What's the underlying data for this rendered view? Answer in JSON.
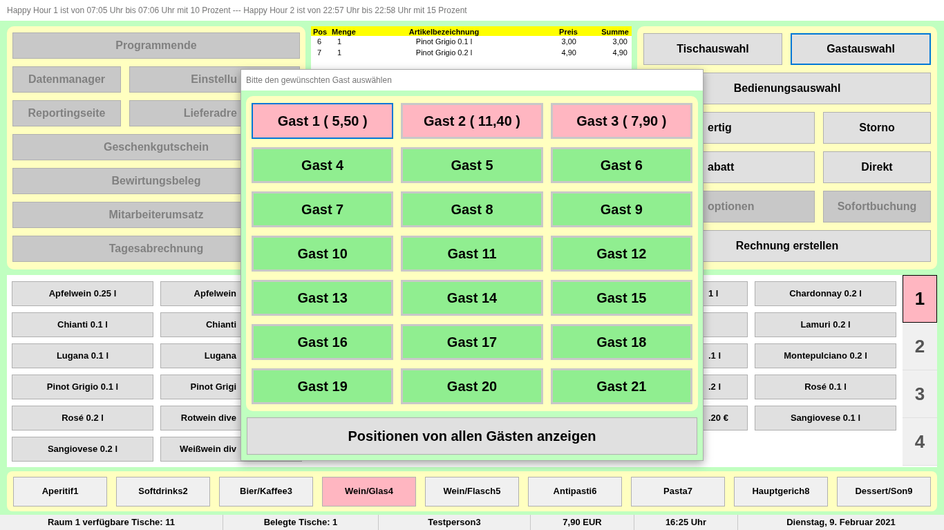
{
  "happy_hour_banner": "Happy Hour 1 ist von 07:05 Uhr bis 07:06 Uhr mit 10 Prozent --- Happy Hour 2 ist von 22:57 Uhr bis 22:58 Uhr mit 15 Prozent",
  "menu_panel": {
    "rows": [
      [
        {
          "label": "Programmende",
          "disabled": true
        }
      ],
      [
        {
          "label": "Datenmanager",
          "disabled": true
        },
        {
          "label": "Einstellu",
          "disabled": true
        }
      ],
      [
        {
          "label": "Reportingseite",
          "disabled": true
        },
        {
          "label": "Lieferadre",
          "disabled": true
        }
      ],
      [
        {
          "label": "Geschenkgutschein",
          "disabled": true
        }
      ],
      [
        {
          "label": "Bewirtungsbeleg",
          "disabled": true
        }
      ],
      [
        {
          "label": "Mitarbeiterumsatz",
          "disabled": true
        }
      ],
      [
        {
          "label": "Tagesabrechnung",
          "disabled": true
        }
      ]
    ]
  },
  "order_table": {
    "columns": [
      "Pos",
      "Menge",
      "Artikelbezeichnung",
      "Preis",
      "Summe"
    ],
    "rows": [
      [
        "6",
        "1",
        "Pinot Grigio 0.1 l",
        "3,00",
        "3,00"
      ],
      [
        "7",
        "1",
        "Pinot Grigio 0.2 l",
        "4,90",
        "4,90"
      ]
    ]
  },
  "action_panel": {
    "rows": [
      [
        {
          "label": "Tischauswahl",
          "disabled": false,
          "focused": false
        },
        {
          "label": "Gastauswahl",
          "disabled": false,
          "focused": true
        }
      ],
      [
        {
          "label": "Bedienungsauswahl",
          "disabled": false,
          "focused": false
        }
      ],
      [
        {
          "label": "ertig",
          "disabled": false,
          "focused": false
        },
        {
          "label": "Storno",
          "disabled": false,
          "focused": false
        }
      ],
      [
        {
          "label": "abatt",
          "disabled": false,
          "focused": false
        },
        {
          "label": "Direkt",
          "disabled": false,
          "focused": false
        }
      ],
      [
        {
          "label": "optionen",
          "disabled": true,
          "focused": false
        },
        {
          "label": "Sofortbuchung",
          "disabled": true,
          "focused": false
        }
      ],
      [
        {
          "label": "Rechnung erstellen",
          "disabled": false,
          "focused": false
        }
      ]
    ]
  },
  "article_columns": [
    [
      {
        "label": "Apfelwein 0.25 l"
      },
      {
        "label": "Chianti 0.1 l"
      },
      {
        "label": "Lugana 0.1 l"
      },
      {
        "label": "Pinot Grigio 0.1 l"
      },
      {
        "label": "Rosé 0.2 l"
      },
      {
        "label": "Sangiovese 0.2 l"
      }
    ],
    [
      {
        "label": "Apfelwein"
      },
      {
        "label": "Chianti"
      },
      {
        "label": "Lugana"
      },
      {
        "label": "Pinot Grigi"
      },
      {
        "label": "Rotwein dive"
      },
      {
        "label": "Weißwein div"
      }
    ],
    [
      {
        "label": "1 l"
      },
      {},
      {
        "label": ".1 l"
      },
      {
        "label": ".2 l"
      },
      {
        "label": ".20 €"
      }
    ],
    [
      {
        "label": "Chardonnay 0.2 l"
      },
      {
        "label": "Lamuri 0.2 l"
      },
      {
        "label": "Montepulciano 0.2 l"
      },
      {
        "label": "Rosé 0.1 l"
      },
      {
        "label": "Sangiovese 0.1 l"
      }
    ]
  ],
  "pages": [
    {
      "label": "1",
      "selected": true
    },
    {
      "label": "2",
      "selected": false
    },
    {
      "label": "3",
      "selected": false
    },
    {
      "label": "4",
      "selected": false
    }
  ],
  "categories": [
    {
      "label": "Aperitif1",
      "selected": false
    },
    {
      "label": "Softdrinks2",
      "selected": false
    },
    {
      "label": "Bier/Kaffee3",
      "selected": false
    },
    {
      "label": "Wein/Glas4",
      "selected": true
    },
    {
      "label": "Wein/Flasch5",
      "selected": false
    },
    {
      "label": "Antipasti6",
      "selected": false
    },
    {
      "label": "Pasta7",
      "selected": false
    },
    {
      "label": "Hauptgerich8",
      "selected": false
    },
    {
      "label": "Dessert/Son9",
      "selected": false
    }
  ],
  "status_bar": [
    "Raum 1 verfügbare Tische: 11",
    "Belegte Tische: 1",
    "Testperson3",
    "7,90 EUR",
    "16:25 Uhr",
    "Dienstag, 9. Februar 2021"
  ],
  "dialog": {
    "title": "Bitte den gewünschten Gast auswählen",
    "guests": [
      {
        "label": "Gast 1 ( 5,50 )",
        "occupied": true,
        "focused": true
      },
      {
        "label": "Gast 2 ( 11,40 )",
        "occupied": true,
        "focused": false
      },
      {
        "label": "Gast 3 ( 7,90 )",
        "occupied": true,
        "focused": false
      },
      {
        "label": "Gast 4",
        "occupied": false,
        "focused": false
      },
      {
        "label": "Gast 5",
        "occupied": false,
        "focused": false
      },
      {
        "label": "Gast 6",
        "occupied": false,
        "focused": false
      },
      {
        "label": "Gast 7",
        "occupied": false,
        "focused": false
      },
      {
        "label": "Gast 8",
        "occupied": false,
        "focused": false
      },
      {
        "label": "Gast 9",
        "occupied": false,
        "focused": false
      },
      {
        "label": "Gast 10",
        "occupied": false,
        "focused": false
      },
      {
        "label": "Gast 11",
        "occupied": false,
        "focused": false
      },
      {
        "label": "Gast 12",
        "occupied": false,
        "focused": false
      },
      {
        "label": "Gast 13",
        "occupied": false,
        "focused": false
      },
      {
        "label": "Gast 14",
        "occupied": false,
        "focused": false
      },
      {
        "label": "Gast 15",
        "occupied": false,
        "focused": false
      },
      {
        "label": "Gast 16",
        "occupied": false,
        "focused": false
      },
      {
        "label": "Gast 17",
        "occupied": false,
        "focused": false
      },
      {
        "label": "Gast 18",
        "occupied": false,
        "focused": false
      },
      {
        "label": "Gast 19",
        "occupied": false,
        "focused": false
      },
      {
        "label": "Gast 20",
        "occupied": false,
        "focused": false
      },
      {
        "label": "Gast 21",
        "occupied": false,
        "focused": false
      }
    ],
    "all_guests_button": "Positionen von allen Gästen anzeigen"
  }
}
